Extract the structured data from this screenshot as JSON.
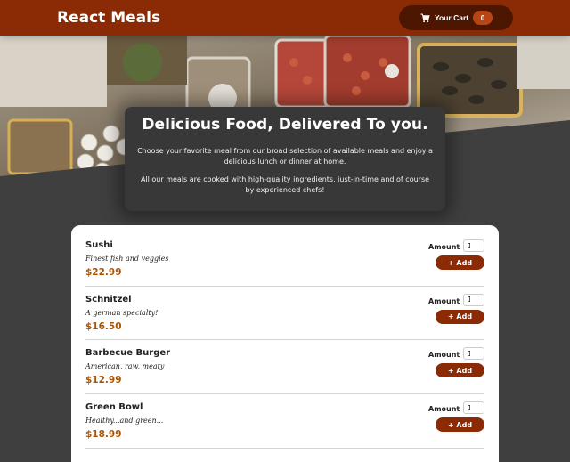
{
  "header": {
    "brand": "React Meals",
    "cart_label": "Your Cart",
    "cart_count": "0",
    "cart_icon": "cart-icon"
  },
  "summary": {
    "title": "Delicious Food, Delivered To you.",
    "paragraph1": "Choose your favorite meal from our broad selection of available meals and enjoy a delicious lunch or dinner at home.",
    "paragraph2": "All our meals are cooked with high-quality ingredients, just-in-time and of course by experienced chefs!"
  },
  "meals": [
    {
      "name": "Sushi",
      "description": "Finest fish and veggies",
      "price": "$22.99",
      "amount_label": "Amount",
      "amount": "1",
      "add_label": "+ Add"
    },
    {
      "name": "Schnitzel",
      "description": "A german specialty!",
      "price": "$16.50",
      "amount_label": "Amount",
      "amount": "1",
      "add_label": "+ Add"
    },
    {
      "name": "Barbecue Burger",
      "description": "American, raw, meaty",
      "price": "$12.99",
      "amount_label": "Amount",
      "amount": "1",
      "add_label": "+ Add"
    },
    {
      "name": "Green Bowl",
      "description": "Healthy...and green...",
      "price": "$18.99",
      "amount_label": "Amount",
      "amount": "1",
      "add_label": "+ Add"
    }
  ],
  "colors": {
    "header": "#8a2b06",
    "cart_button": "#4d1601",
    "badge": "#b94517",
    "background": "#3f3f3f",
    "price": "#ad5502"
  }
}
